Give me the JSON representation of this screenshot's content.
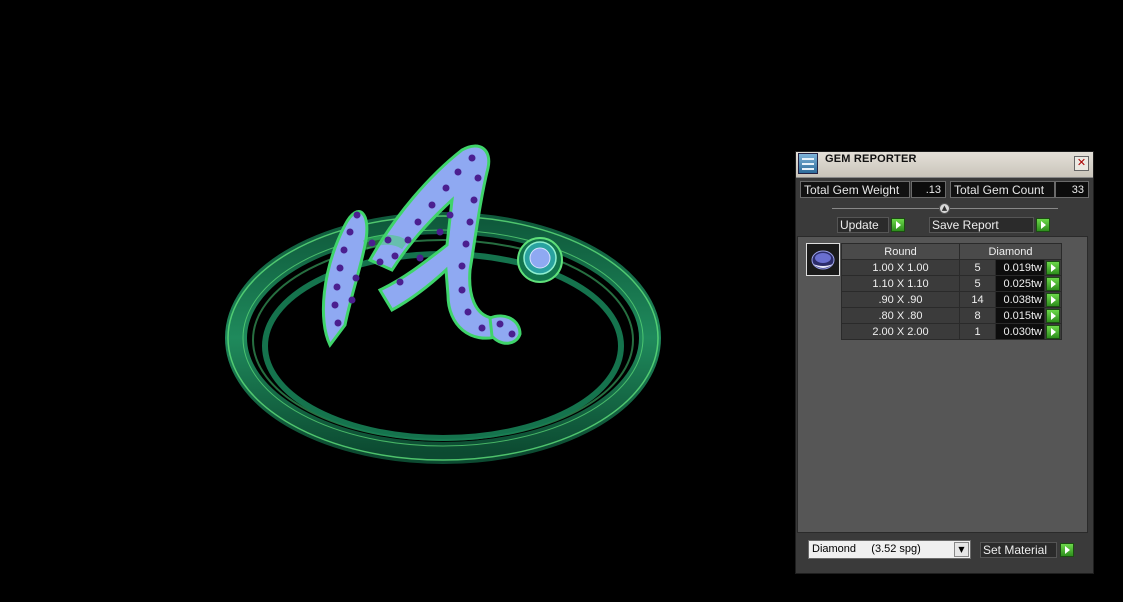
{
  "panel": {
    "title": "GEM REPORTER",
    "close_glyph": "✕",
    "total_weight_label": "Total Gem Weight",
    "total_weight_value": ".13",
    "total_count_label": "Total Gem Count",
    "total_count_value": "33",
    "update_label": "Update",
    "save_report_label": "Save Report",
    "table": {
      "headers": [
        "Round",
        "Diamond"
      ],
      "rows": [
        {
          "size": "1.00 X 1.00",
          "count": "5",
          "weight": "0.019tw"
        },
        {
          "size": "1.10 X 1.10",
          "count": "5",
          "weight": "0.025tw"
        },
        {
          "size": ".90 X .90",
          "count": "14",
          "weight": "0.038tw"
        },
        {
          "size": ".80 X .80",
          "count": "8",
          "weight": "0.015tw"
        },
        {
          "size": "2.00 X 2.00",
          "count": "1",
          "weight": "0.030tw"
        }
      ]
    },
    "material_select_value": "Diamond     (3.52 spg)",
    "set_material_label": "Set Material"
  },
  "icons": {
    "app": "gem-reporter-app-icon",
    "close": "close-icon",
    "go": "green-arrow-icon",
    "gem": "round-gem-icon",
    "dropdown": "chevron-down-icon"
  },
  "colors": {
    "ring_metal": "#1f8a5c",
    "ring_highlight": "#7cf07a",
    "pave_fill": "#8fa9f2",
    "gem_dot": "#4b1f8f",
    "go_button": "#3cb82a"
  }
}
